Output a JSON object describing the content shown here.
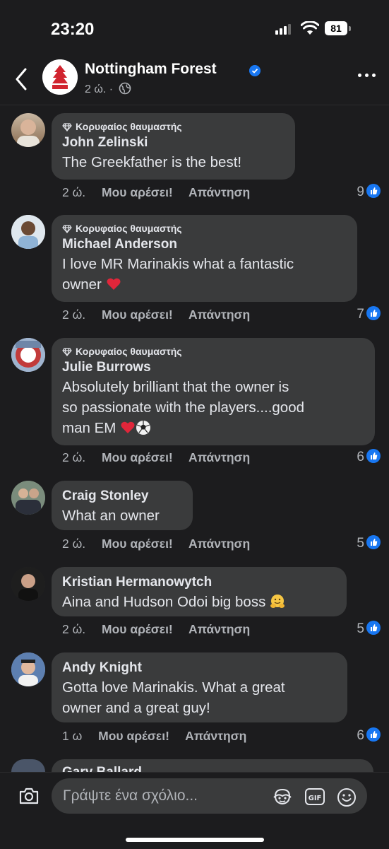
{
  "status_bar": {
    "time": "23:20",
    "battery": "81"
  },
  "header": {
    "page_name": "Nottingham Forest",
    "meta": "2 ώ. ·"
  },
  "comments": [
    {
      "badge": "Κορυφαίος θαυμαστής",
      "author": "John Zelinski",
      "lines": [
        "The Greekfather is the best!"
      ],
      "time": "2 ώ.",
      "like": "Μου αρέσει!",
      "reply": "Απάντηση",
      "reactions": "9"
    },
    {
      "badge": "Κορυφαίος θαυμαστής",
      "author": "Michael Anderson",
      "lines": [
        "I love MR Marinakis what a fantastic",
        "owner"
      ],
      "time": "2 ώ.",
      "like": "Μου αρέσει!",
      "reply": "Απάντηση",
      "reactions": "7"
    },
    {
      "badge": "Κορυφαίος θαυμαστής",
      "author": "Julie Burrows",
      "lines": [
        "Absolutely brilliant that the owner is",
        "so passionate with the players....good",
        "man EM"
      ],
      "time": "2 ώ.",
      "like": "Μου αρέσει!",
      "reply": "Απάντηση",
      "reactions": "6"
    },
    {
      "author": "Craig Stonley",
      "lines": [
        "What an owner"
      ],
      "time": "2 ώ.",
      "like": "Μου αρέσει!",
      "reply": "Απάντηση",
      "reactions": "5"
    },
    {
      "author": "Kristian Hermanowytch",
      "lines": [
        "Aina and Hudson Odoi big boss"
      ],
      "time": "2 ώ.",
      "like": "Μου αρέσει!",
      "reply": "Απάντηση",
      "reactions": "5"
    },
    {
      "author": "Andy Knight",
      "lines": [
        "Gotta love Marinakis. What a great",
        "owner and a great guy!"
      ],
      "time": "1 ω",
      "like": "Μου αρέσει!",
      "reply": "Απάντηση",
      "reactions": "6"
    }
  ],
  "partial_comment": {
    "author": "Gary Ballard"
  },
  "composer": {
    "placeholder": "Γράψτε ένα σχόλιο..."
  },
  "icons": [
    "back-icon",
    "globe-icon",
    "more-icon",
    "diamond-icon",
    "like-reaction-icon",
    "heart-emoji",
    "soccer-ball-emoji",
    "hugging-face-emoji",
    "camera-icon",
    "avatar-sticker-icon",
    "gif-icon",
    "emoji-icon"
  ],
  "colors": {
    "background": "#1c1c1e",
    "bubble": "#3a3b3c",
    "accent": "#1877f2"
  }
}
